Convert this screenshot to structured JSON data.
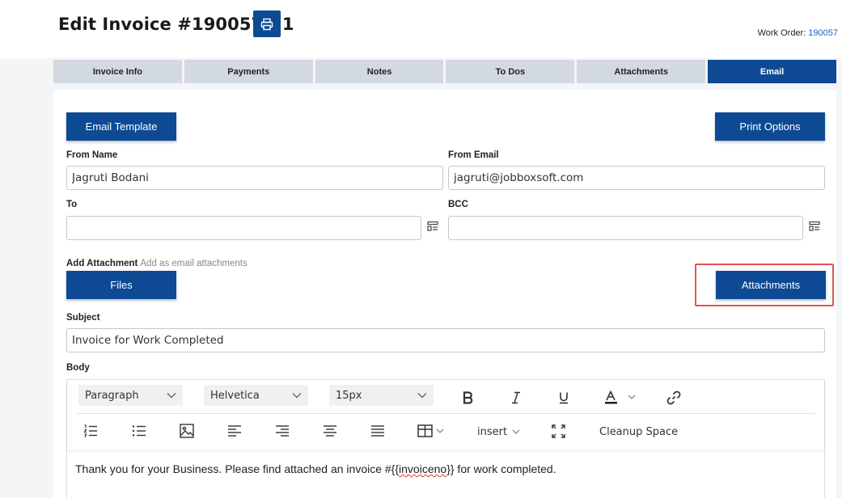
{
  "header": {
    "title": "Edit Invoice #190057 - 1",
    "work_order_label": "Work Order:",
    "work_order_number": "190057"
  },
  "tabs": [
    {
      "label": "Invoice Info"
    },
    {
      "label": "Payments"
    },
    {
      "label": "Notes"
    },
    {
      "label": "To Dos"
    },
    {
      "label": "Attachments"
    },
    {
      "label": "Email",
      "active": true
    }
  ],
  "buttons": {
    "email_template": "Email Template",
    "print_options": "Print Options",
    "files": "Files",
    "attachments": "Attachments"
  },
  "form": {
    "from_name_label": "From Name",
    "from_name_value": "Jagruti Bodani",
    "from_email_label": "From Email",
    "from_email_value": "jagruti@jobboxsoft.com",
    "to_label": "To",
    "to_value": "",
    "bcc_label": "BCC",
    "bcc_value": "",
    "add_attachment_label": "Add Attachment",
    "add_attachment_hint": "Add as email attachments",
    "subject_label": "Subject",
    "subject_value": "Invoice for Work Completed",
    "body_label": "Body"
  },
  "editor": {
    "paragraph_select": "Paragraph",
    "font_select": "Helvetica",
    "size_select": "15px",
    "insert_label": "insert",
    "cleanup_label": "Cleanup Space",
    "body_text_before": "Thank you for your Business. Please find attached an invoice #{{",
    "body_text_token": "invoiceno",
    "body_text_after": "}} for work completed."
  },
  "colors": {
    "primary": "#0d4a93",
    "tab_inactive": "#d3d9e0",
    "highlight": "#e05555",
    "link": "#1565c0"
  }
}
